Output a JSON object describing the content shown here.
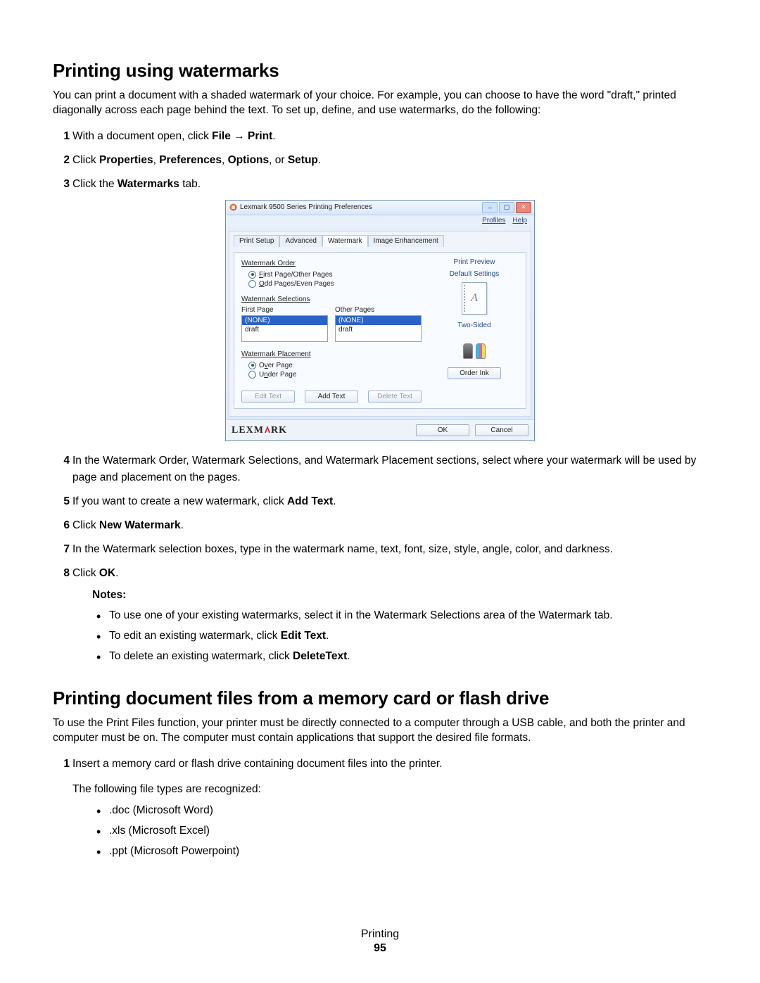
{
  "headings": {
    "h1": "Printing using watermarks",
    "h2": "Printing document files from a memory card or flash drive"
  },
  "intro1": "You can print a document with a shaded watermark of your choice. For example, you can choose to have the word \"draft,\" printed diagonally across each page behind the text. To set up, define, and use watermarks, do the following:",
  "steps1": {
    "s1a": "With a document open, click ",
    "s1b": "File",
    "s1arrow": " → ",
    "s1c": "Print",
    "s1d": ".",
    "s2a": "Click ",
    "s2b": "Properties",
    "s2c": ", ",
    "s2d": "Preferences",
    "s2e": ", ",
    "s2f": "Options",
    "s2g": ", or ",
    "s2h": "Setup",
    "s2i": ".",
    "s3a": "Click the ",
    "s3b": "Watermarks",
    "s3c": " tab.",
    "s4": "In the Watermark Order, Watermark Selections, and Watermark Placement sections, select where your watermark will be used by page and placement on the pages.",
    "s5a": "If you want to create a new watermark, click ",
    "s5b": "Add Text",
    "s5c": ".",
    "s6a": "Click ",
    "s6b": "New Watermark",
    "s6c": ".",
    "s7": "In the Watermark selection boxes, type in the watermark name, text, font, size, style, angle, color, and darkness.",
    "s8a": "Click ",
    "s8b": "OK",
    "s8c": "."
  },
  "notes": {
    "label": "Notes:",
    "n1": "To use one of your existing watermarks, select it in the Watermark Selections area of the Watermark tab.",
    "n2a": "To edit an existing watermark, click ",
    "n2b": "Edit Text",
    "n2c": ".",
    "n3a": "To delete an existing watermark, click ",
    "n3b": "DeleteText",
    "n3c": "."
  },
  "intro2": "To use the Print Files function, your printer must be directly connected to a computer through a USB cable, and both the printer and computer must be on. The computer must contain applications that support the desired file formats.",
  "steps2": {
    "s1": "Insert a memory card or flash drive containing document files into the printer.",
    "sub": "The following file types are recognized:",
    "b1": ".doc (Microsoft Word)",
    "b2": ".xls (Microsoft Excel)",
    "b3": ".ppt (Microsoft Powerpoint)"
  },
  "footer": {
    "label": "Printing",
    "page": "95"
  },
  "dialog": {
    "title": "Lexmark 9500 Series Printing Preferences",
    "toolbar": {
      "profiles": "Profiles",
      "help": "Help"
    },
    "tabs": {
      "t1": "Print Setup",
      "t2": "Advanced",
      "t3": "Watermark",
      "t4": "Image Enhancement"
    },
    "groups": {
      "order": {
        "title": "Watermark Order",
        "r1": "First Page/Other Pages",
        "r2": "Odd Pages/Even Pages"
      },
      "selections": {
        "title": "Watermark Selections",
        "col1": "First Page",
        "col2": "Other Pages",
        "none": "(NONE)",
        "draft": "draft"
      },
      "placement": {
        "title": "Watermark Placement",
        "r1": "Over Page",
        "r2": "Under Page"
      }
    },
    "buttons": {
      "edit": "Edit Text",
      "add": "Add Text",
      "delete": "Delete Text",
      "ok": "OK",
      "cancel": "Cancel",
      "order_ink": "Order Ink"
    },
    "right": {
      "preview": "Print Preview",
      "defaults": "Default Settings",
      "twosided": "Two-Sided",
      "letter": "A"
    },
    "brand": "LEXM",
    "brand2": "RK"
  }
}
